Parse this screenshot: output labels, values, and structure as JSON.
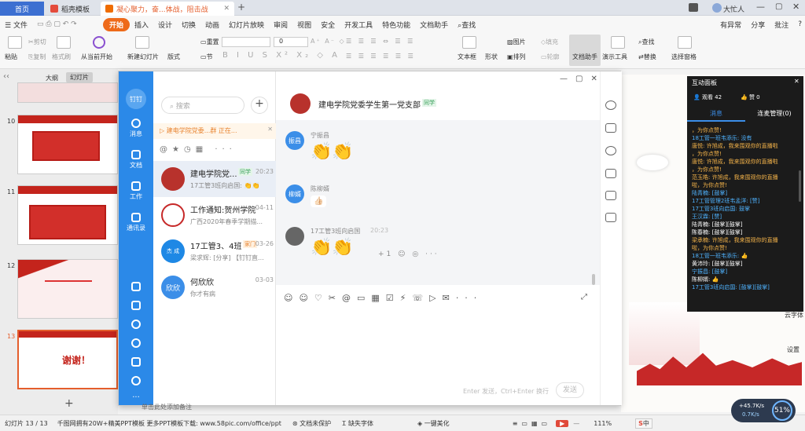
{
  "tabs": {
    "home": "首页",
    "template": "稻壳模板",
    "doc": "凝心聚力，奋...体战，阻击战"
  },
  "window": {
    "user": "大忙人"
  },
  "menu": {
    "file": "文件",
    "start": "开始",
    "insert": "插入",
    "design": "设计",
    "switch": "切换",
    "animation": "动画",
    "slideshow": "幻灯片放映",
    "review": "审阅",
    "view": "视图",
    "security": "安全",
    "dev": "开发工具",
    "special": "特色功能",
    "doc_helper": "文档助手",
    "search": "查找",
    "changes": "有异常",
    "share": "分享",
    "comment": "批注"
  },
  "ribbon": {
    "paste": "粘贴",
    "cut": "剪切",
    "copy": "复制",
    "format_painter": "格式刷",
    "from_current": "从当前开始",
    "new_slide": "新建幻灯片",
    "layout": "版式",
    "section": "节",
    "reset": "重置",
    "font_size": "0",
    "textbox": "文本框",
    "shape": "形状",
    "arrange": "排列",
    "picture": "图片",
    "fill": "填充",
    "outline": "轮廓",
    "doc_helper": "文档助手",
    "presentation_tools": "演示工具",
    "find": "查找",
    "replace": "替换",
    "select_pane": "选择窗格"
  },
  "slides": {
    "outline": "大纲",
    "slides": "幻灯片",
    "items": [
      {
        "num": "10"
      },
      {
        "num": "11"
      },
      {
        "num": "12"
      },
      {
        "num": "13"
      }
    ],
    "thanks": "谢谢！"
  },
  "chat": {
    "search_placeholder": "搜索",
    "notice": "建电学院党委...群 正在...",
    "rail": {
      "messages": "消息",
      "docs": "文档",
      "work": "工作",
      "contacts": "通讯录",
      "logo": "钉钉"
    },
    "convs": [
      {
        "name": "建电学院党...",
        "tag": "同学",
        "time": "20:23",
        "preview": "17工管3班向启国:",
        "avatar": "",
        "color": "#b8322c"
      },
      {
        "name": "工作通知:贺州学院",
        "time": "04-11",
        "preview": "广西2020年春季学期描...",
        "avatar": "",
        "color": "#c62828"
      },
      {
        "name": "17工管3、4班",
        "tag": "家门",
        "time": "03-26",
        "preview": "梁求辉: [分享] 【钉钉直...",
        "avatar": "杰 成",
        "color": "#1e88e5"
      },
      {
        "name": "何欣欣",
        "time": "03-03",
        "preview": "你才有病",
        "avatar": "欣欣",
        "color": "#3b8ee8"
      }
    ],
    "group_title": "建电学院党委学生第一党支部",
    "group_tag": "同学",
    "messages": [
      {
        "avatar": "振昌",
        "name": "宁振昌",
        "emoji": "👏👏"
      },
      {
        "avatar": "柳婿",
        "name": "陈柳婿",
        "emoji": "👍🏻"
      },
      {
        "avatar": "",
        "name": "17工管3班向启国",
        "time": "20:23",
        "emoji": "👏👏"
      }
    ],
    "input_hint": "Enter 发送，Ctrl+Enter 换行",
    "send": "发送"
  },
  "interaction": {
    "title": "互动面板",
    "viewers": "观看 42",
    "likes": "赞 0",
    "tab_msgs": "消息",
    "tab_mic": "连麦管理(0)",
    "lines": [
      {
        "t": "，为你点赞!",
        "c": "#f5b44a"
      },
      {
        "t": "18工管一班韦添乐: 没有",
        "c": "#4fb3ff"
      },
      {
        "t": "唐悦: 许旭成，我来围观你的直播啦",
        "c": "#f5b44a"
      },
      {
        "t": "，为你点赞!",
        "c": "#f5b44a"
      },
      {
        "t": "唐悦: 许旭成，我来围观你的直播啦",
        "c": "#f5b44a"
      },
      {
        "t": "，为你点赞!",
        "c": "#f5b44a"
      },
      {
        "t": "范玉皓: 许旭成，我来围观你的直播",
        "c": "#f5b44a"
      },
      {
        "t": "啦，为你点赞!",
        "c": "#f5b44a"
      },
      {
        "t": "陆青楠: [鼓掌]",
        "c": "#4fb3ff"
      },
      {
        "t": "17工管管理2班韦孟洋: [赞]",
        "c": "#4fb3ff"
      },
      {
        "t": "17工管3班向启国: 鼓掌",
        "c": "#4fb3ff"
      },
      {
        "t": "王汉霖: [赞]",
        "c": "#4fb3ff"
      },
      {
        "t": "陆青楠: [鼓掌][鼓掌]",
        "c": "#ffffff"
      },
      {
        "t": "陈春楠: [鼓掌][鼓掌]",
        "c": "#ffffff"
      },
      {
        "t": "梁承楠: 许旭成，我来围观你的直播",
        "c": "#f5b44a"
      },
      {
        "t": "啦，为你点赞!",
        "c": "#f5b44a"
      },
      {
        "t": "18工管一班韦添乐: 👍",
        "c": "#4fb3ff"
      },
      {
        "t": "黄沛玲: [鼓掌][鼓掌]",
        "c": "#ffffff"
      },
      {
        "t": "宁振昌: [鼓掌]",
        "c": "#4fb3ff"
      },
      {
        "t": "陈柳婿: 👍",
        "c": "#ffffff"
      },
      {
        "t": "17工管3班向启国: [鼓掌][鼓掌]",
        "c": "#4fb3ff"
      }
    ]
  },
  "side": {
    "cloud": "云字体",
    "settings": "设置"
  },
  "status": {
    "slide": "幻灯片 13 / 13",
    "promo": "千图网拥有20W+精美PPT模板 更多PPT模板下载: www.58pic.com/office/ppt",
    "protect": "文档未保护",
    "missing_font": "缺失字体",
    "beautify": "一键美化",
    "zoom": "111%",
    "net_up": "+45.7",
    "net_down": "0.7",
    "net_unit": "K/s",
    "cpu": "51%",
    "ime": "中",
    "notes": "单击此处添加备注"
  }
}
